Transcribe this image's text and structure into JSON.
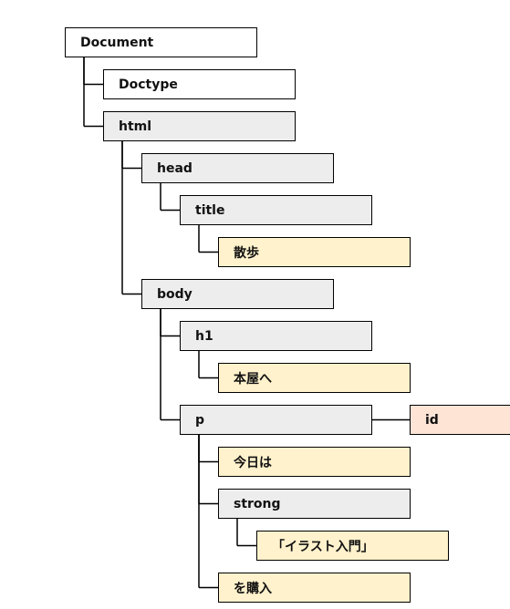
{
  "colors": {
    "document": "#ffffff",
    "element": "#ededed",
    "text": "#fff2cc",
    "attribute": "#fde4d5"
  },
  "nodes": [
    {
      "label": "Document",
      "kind": "document",
      "level": 0,
      "parent": null
    },
    {
      "label": "Doctype",
      "kind": "document",
      "level": 1,
      "parent": 0
    },
    {
      "label": "html",
      "kind": "element",
      "level": 1,
      "parent": 0
    },
    {
      "label": "head",
      "kind": "element",
      "level": 2,
      "parent": 2
    },
    {
      "label": "title",
      "kind": "element",
      "level": 3,
      "parent": 3
    },
    {
      "label": "散歩",
      "kind": "text",
      "level": 4,
      "parent": 4
    },
    {
      "label": "body",
      "kind": "element",
      "level": 2,
      "parent": 2
    },
    {
      "label": "h1",
      "kind": "element",
      "level": 3,
      "parent": 6
    },
    {
      "label": "本屋へ",
      "kind": "text",
      "level": 4,
      "parent": 7
    },
    {
      "label": "p",
      "kind": "element",
      "level": 3,
      "parent": 6
    },
    {
      "label": "今日は",
      "kind": "text",
      "level": 4,
      "parent": 9
    },
    {
      "label": "strong",
      "kind": "element",
      "level": 4,
      "parent": 9
    },
    {
      "label": "「イラスト入門」",
      "kind": "text",
      "level": 5,
      "parent": 11
    },
    {
      "label": "を購入",
      "kind": "text",
      "level": 4,
      "parent": 9
    }
  ],
  "attribute": {
    "label": "id",
    "kind": "attribute",
    "owner": 9
  }
}
